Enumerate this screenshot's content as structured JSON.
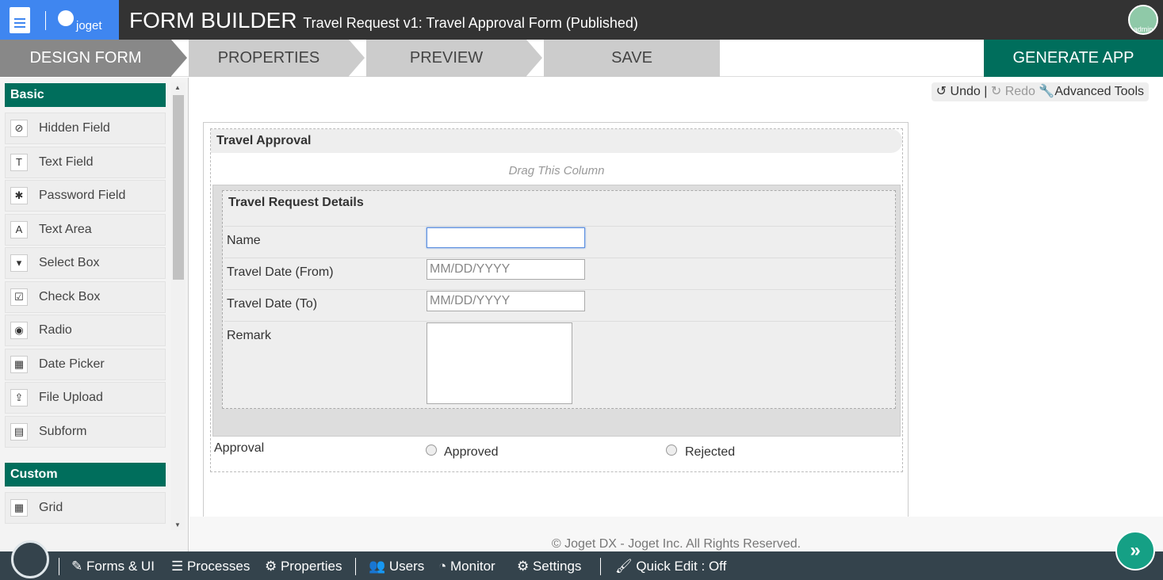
{
  "header": {
    "brand": "joget",
    "title": "FORM BUILDER",
    "subtitle": "Travel Request v1: Travel Approval Form (Published)",
    "user": "admin"
  },
  "steps": [
    "DESIGN FORM",
    "PROPERTIES",
    "PREVIEW",
    "SAVE"
  ],
  "generate_label": "GENERATE APP",
  "palette": {
    "basic_label": "Basic",
    "basic": [
      {
        "label": "Hidden Field",
        "icon": "⊘"
      },
      {
        "label": "Text Field",
        "icon": "T"
      },
      {
        "label": "Password Field",
        "icon": "✱"
      },
      {
        "label": "Text Area",
        "icon": "A"
      },
      {
        "label": "Select Box",
        "icon": "▾"
      },
      {
        "label": "Check Box",
        "icon": "☑"
      },
      {
        "label": "Radio",
        "icon": "◉"
      },
      {
        "label": "Date Picker",
        "icon": "▦"
      },
      {
        "label": "File Upload",
        "icon": "⇪"
      },
      {
        "label": "Subform",
        "icon": "▤"
      }
    ],
    "custom_label": "Custom",
    "custom": [
      {
        "label": "Grid",
        "icon": "▦"
      }
    ]
  },
  "tools": {
    "undo": "Undo",
    "sep": "|",
    "redo": "Redo",
    "advanced": "Advanced Tools"
  },
  "form": {
    "section1": "Travel Approval",
    "drag": "Drag This Column",
    "section2": "Travel Request Details",
    "fields": [
      {
        "label": "Name",
        "value": ""
      },
      {
        "label": "Travel Date (From)",
        "placeholder": "MM/DD/YYYY"
      },
      {
        "label": "Travel Date (To)",
        "placeholder": "MM/DD/YYYY"
      },
      {
        "label": "Remark"
      }
    ],
    "approval": {
      "label": "Approval",
      "options": [
        "Approved",
        "Rejected"
      ]
    }
  },
  "footer": "© Joget DX - Joget Inc. All Rights Reserved.",
  "bottom": [
    "Forms & UI",
    "Processes",
    "Properties",
    "Users",
    "Monitor",
    "Settings",
    "Quick Edit : Off"
  ]
}
